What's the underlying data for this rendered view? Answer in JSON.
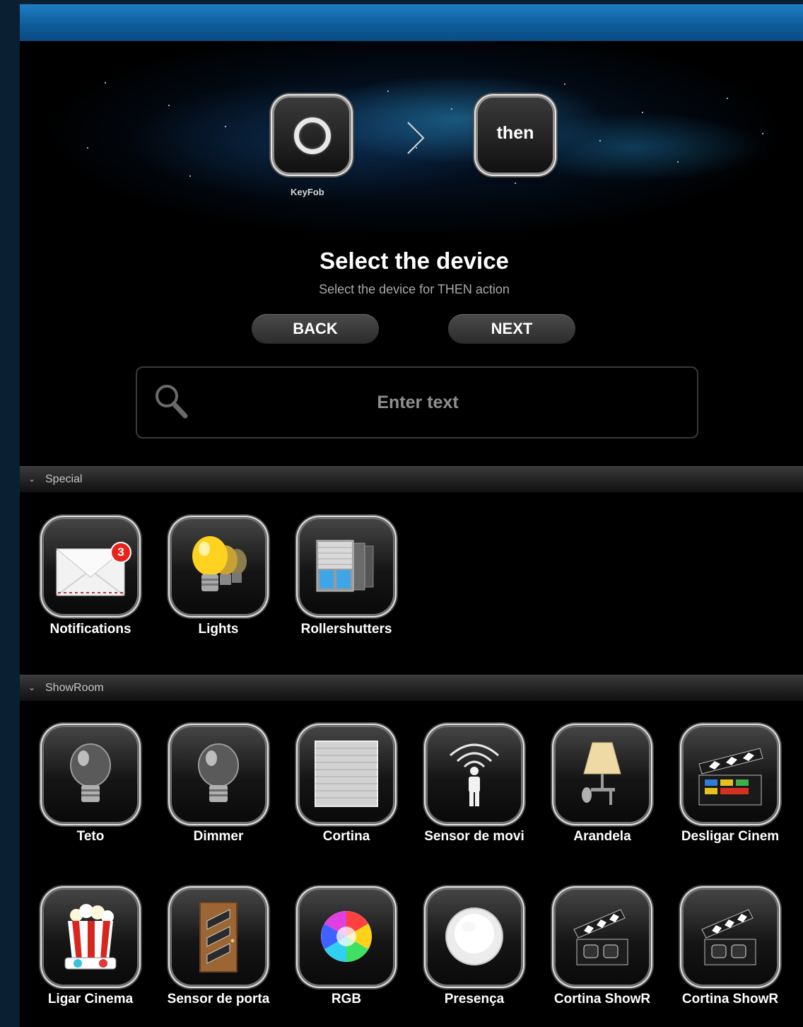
{
  "flow": {
    "trigger_label": "KeyFob",
    "action_label": "then"
  },
  "header": {
    "title": "Select the device",
    "subtitle": "Select the device for THEN action"
  },
  "buttons": {
    "back": "BACK",
    "next": "NEXT"
  },
  "search": {
    "placeholder": "Enter text"
  },
  "sections": [
    {
      "title": "Special",
      "devices": [
        {
          "label": "Notifications",
          "icon": "envelope-icon",
          "badge": "3"
        },
        {
          "label": "Lights",
          "icon": "bulbs-icon"
        },
        {
          "label": "Rollershutters",
          "icon": "windows-icon"
        }
      ]
    },
    {
      "title": "ShowRoom",
      "devices": [
        {
          "label": "Teto",
          "icon": "light-bulb-icon"
        },
        {
          "label": "Dimmer",
          "icon": "light-bulb-icon"
        },
        {
          "label": "Cortina",
          "icon": "curtain-icon"
        },
        {
          "label": "Sensor de movi",
          "icon": "motion-sensor-icon"
        },
        {
          "label": "Arandela",
          "icon": "wall-lamp-icon"
        },
        {
          "label": "Desligar Cinem",
          "icon": "clapperboard-icon"
        },
        {
          "label": "Ligar Cinema",
          "icon": "popcorn-icon"
        },
        {
          "label": "Sensor de porta",
          "icon": "door-icon"
        },
        {
          "label": "RGB",
          "icon": "color-wheel-icon"
        },
        {
          "label": "Presença",
          "icon": "presence-sensor-icon"
        },
        {
          "label": "Cortina ShowR",
          "icon": "scene-icon"
        },
        {
          "label": "Cortina ShowR",
          "icon": "scene-icon"
        }
      ]
    }
  ]
}
